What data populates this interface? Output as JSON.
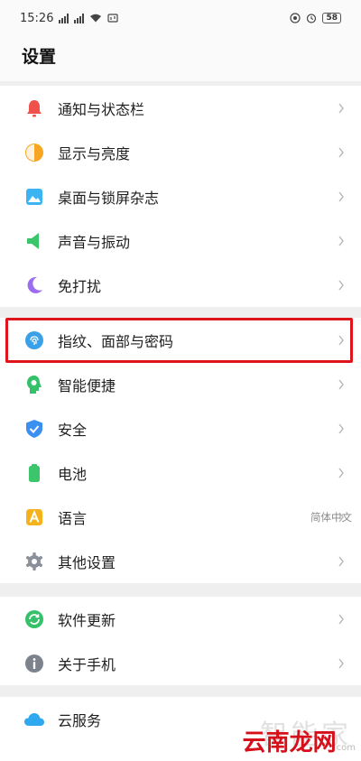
{
  "status_bar": {
    "time": "15:26",
    "battery": "58"
  },
  "header": {
    "title": "设置"
  },
  "groups": [
    {
      "items": [
        {
          "label": "通知与状态栏",
          "icon": "bell-icon",
          "color": "#f0514a"
        },
        {
          "label": "显示与亮度",
          "icon": "brightness-icon",
          "color": "#f5a623"
        },
        {
          "label": "桌面与锁屏杂志",
          "icon": "wallpaper-icon",
          "color": "#3ab4f2"
        },
        {
          "label": "声音与振动",
          "icon": "speaker-icon",
          "color": "#3cc66b"
        },
        {
          "label": "免打扰",
          "icon": "moon-icon",
          "color": "#9b6cf0"
        }
      ]
    },
    {
      "items": [
        {
          "label": "指纹、面部与密码",
          "icon": "fingerprint-icon",
          "color": "#3aa0e8"
        },
        {
          "label": "智能便捷",
          "icon": "smart-head-icon",
          "color": "#35c16a"
        },
        {
          "label": "安全",
          "icon": "shield-check-icon",
          "color": "#3a8ff0"
        },
        {
          "label": "电池",
          "icon": "battery-icon",
          "color": "#3cc66b"
        },
        {
          "label": "语言",
          "icon": "language-icon",
          "color": "#f5b21a",
          "value": "简体中文"
        },
        {
          "label": "其他设置",
          "icon": "gear-icon",
          "color": "#8a9099"
        }
      ]
    },
    {
      "items": [
        {
          "label": "软件更新",
          "icon": "update-icon",
          "color": "#35c16a"
        },
        {
          "label": "关于手机",
          "icon": "info-icon",
          "color": "#7d838c"
        }
      ]
    },
    {
      "items": [
        {
          "label": "云服务",
          "icon": "cloud-icon",
          "color": "#2fa8f0"
        }
      ]
    }
  ],
  "watermark": {
    "top": "智能家",
    "bottom": "云南龙网",
    "bottom_sub": "com"
  },
  "highlight_color": "#e0151b"
}
